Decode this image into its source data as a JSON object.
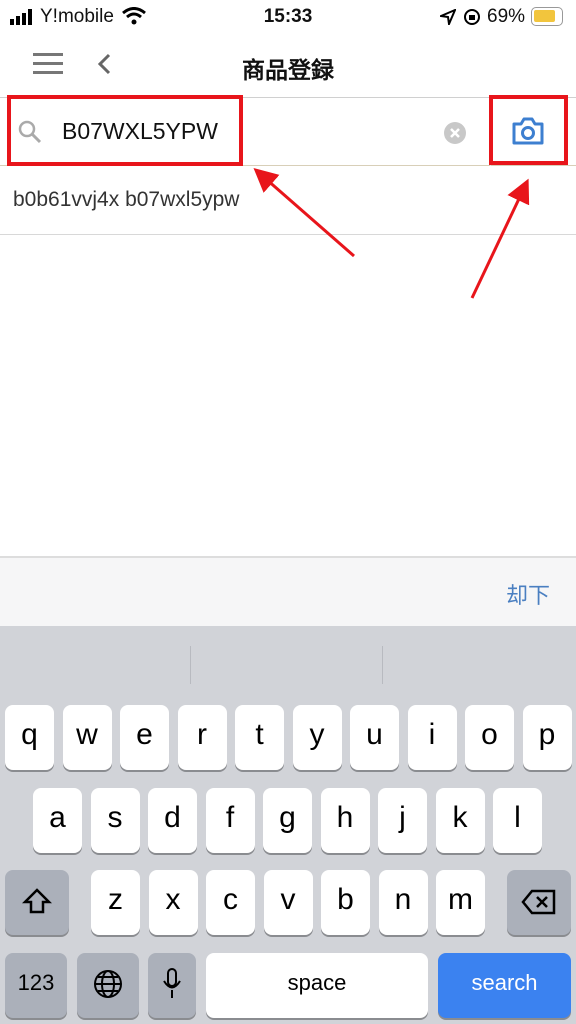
{
  "status": {
    "carrier": "Y!mobile",
    "time": "15:33",
    "battery": "69%",
    "battery_level": 0.69,
    "battery_color": "#f2c53d"
  },
  "nav": {
    "title": "商品登録",
    "menu_icon": "hamburger-icon",
    "back_icon": "chevron-left-icon"
  },
  "search": {
    "value": "B07WXL5YPW",
    "camera_icon": "camera-icon",
    "accent": "#3d7fd0"
  },
  "suggestions": [
    "b0b61vvj4x b07wxl5ypw"
  ],
  "toolbar": {
    "done": "却下"
  },
  "keyboard": {
    "row1": [
      "q",
      "w",
      "e",
      "r",
      "t",
      "y",
      "u",
      "i",
      "o",
      "p"
    ],
    "row2": [
      "a",
      "s",
      "d",
      "f",
      "g",
      "h",
      "j",
      "k",
      "l"
    ],
    "row3": [
      "z",
      "x",
      "c",
      "v",
      "b",
      "n",
      "m"
    ],
    "numbers": "123",
    "space": "space",
    "search": "search",
    "search_color": "#3b82f0"
  },
  "annotation_color": "#e8151b"
}
